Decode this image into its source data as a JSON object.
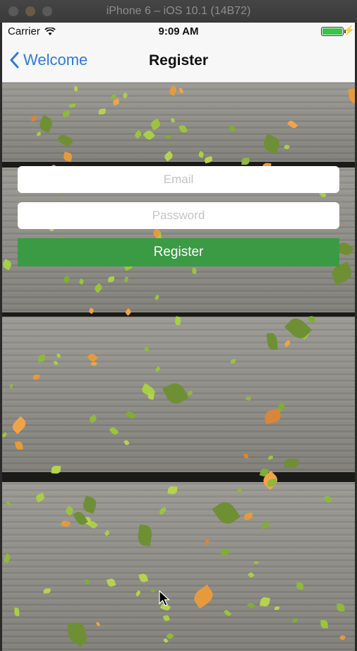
{
  "window": {
    "title": "iPhone 6 – iOS 10.1 (14B72)"
  },
  "status_bar": {
    "carrier": "Carrier",
    "time": "9:09 AM",
    "battery_level": 1.0
  },
  "nav": {
    "back_label": "Welcome",
    "title": "Register"
  },
  "form": {
    "email_placeholder": "Email",
    "password_placeholder": "Password",
    "register_label": "Register"
  },
  "colors": {
    "accent_blue": "#2f7bd6",
    "register_green": "#3b9a44",
    "battery_green": "#3cc14b"
  },
  "icons": [
    "wifi-icon",
    "chevron-left-icon",
    "battery-icon",
    "mouse-cursor-icon"
  ]
}
